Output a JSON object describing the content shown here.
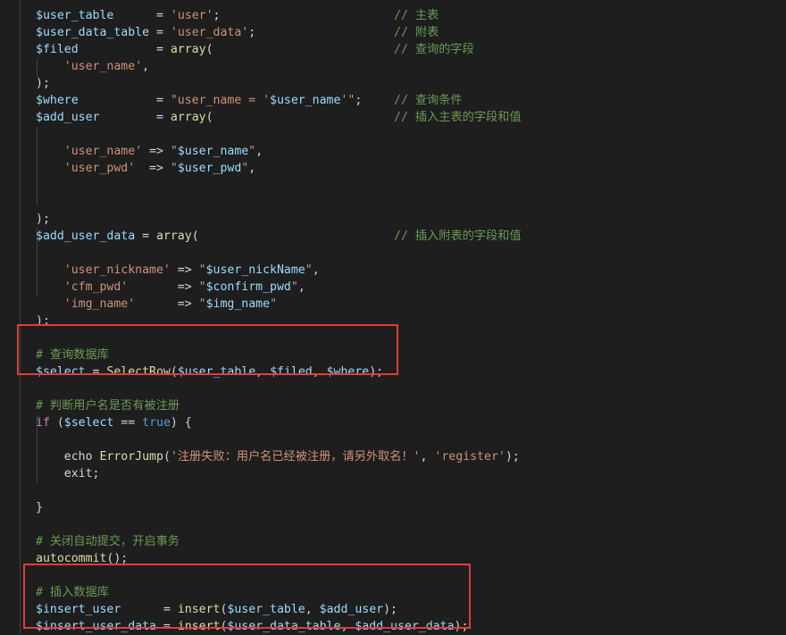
{
  "editor": {
    "theme_colors": {
      "background": "#1e1e1e",
      "variable": "#9cdcfe",
      "string": "#ce9178",
      "function": "#dcdcaa",
      "comment": "#6a9955",
      "keyword": "#569cd6",
      "highlight_box": "#e03c3c"
    },
    "lines": [
      [
        {
          "t": "v",
          "x": "$user_table"
        },
        {
          "t": "p",
          "x": "      = "
        },
        {
          "t": "s",
          "x": "'user'"
        },
        {
          "t": "p",
          "x": ";"
        },
        {
          "t": "c",
          "x": "// 主表",
          "col": 40
        }
      ],
      [
        {
          "t": "v",
          "x": "$user_data_table"
        },
        {
          "t": "p",
          "x": " = "
        },
        {
          "t": "s",
          "x": "'user_data'"
        },
        {
          "t": "p",
          "x": ";"
        },
        {
          "t": "c",
          "x": "// 附表",
          "col": 40
        }
      ],
      [
        {
          "t": "v",
          "x": "$filed"
        },
        {
          "t": "p",
          "x": "           = "
        },
        {
          "t": "f",
          "x": "array"
        },
        {
          "t": "p",
          "x": "("
        },
        {
          "t": "c",
          "x": "// 查询的字段",
          "col": 40
        }
      ],
      [
        {
          "t": "p",
          "x": "    "
        },
        {
          "t": "s",
          "x": "'user_name'"
        },
        {
          "t": "p",
          "x": ","
        }
      ],
      [
        {
          "t": "p",
          "x": ");"
        }
      ],
      [
        {
          "t": "v",
          "x": "$where"
        },
        {
          "t": "p",
          "x": "           = "
        },
        {
          "t": "s",
          "x": "\"user_name = '"
        },
        {
          "t": "v",
          "x": "$user_name"
        },
        {
          "t": "s",
          "x": "'\""
        },
        {
          "t": "p",
          "x": ";"
        },
        {
          "t": "c",
          "x": "// 查询条件",
          "col": 40
        }
      ],
      [
        {
          "t": "v",
          "x": "$add_user"
        },
        {
          "t": "p",
          "x": "        = "
        },
        {
          "t": "f",
          "x": "array"
        },
        {
          "t": "p",
          "x": "("
        },
        {
          "t": "c",
          "x": "// 插入主表的字段和值",
          "col": 40
        }
      ],
      [],
      [
        {
          "t": "p",
          "x": "    "
        },
        {
          "t": "s",
          "x": "'user_name'"
        },
        {
          "t": "p",
          "x": " => "
        },
        {
          "t": "s",
          "x": "\""
        },
        {
          "t": "v",
          "x": "$user_name"
        },
        {
          "t": "s",
          "x": "\""
        },
        {
          "t": "p",
          "x": ","
        }
      ],
      [
        {
          "t": "p",
          "x": "    "
        },
        {
          "t": "s",
          "x": "'user_pwd'"
        },
        {
          "t": "p",
          "x": "  => "
        },
        {
          "t": "s",
          "x": "\""
        },
        {
          "t": "v",
          "x": "$user_pwd"
        },
        {
          "t": "s",
          "x": "\""
        },
        {
          "t": "p",
          "x": ","
        }
      ],
      [],
      [],
      [
        {
          "t": "p",
          "x": ");"
        }
      ],
      [
        {
          "t": "v",
          "x": "$add_user_data"
        },
        {
          "t": "p",
          "x": " = "
        },
        {
          "t": "f",
          "x": "array"
        },
        {
          "t": "p",
          "x": "("
        },
        {
          "t": "c",
          "x": "// 插入附表的字段和值",
          "col": 40
        }
      ],
      [],
      [
        {
          "t": "p",
          "x": "    "
        },
        {
          "t": "s",
          "x": "'user_nickname'"
        },
        {
          "t": "p",
          "x": " => "
        },
        {
          "t": "s",
          "x": "\""
        },
        {
          "t": "v",
          "x": "$user_nickName"
        },
        {
          "t": "s",
          "x": "\""
        },
        {
          "t": "p",
          "x": ","
        }
      ],
      [
        {
          "t": "p",
          "x": "    "
        },
        {
          "t": "s",
          "x": "'cfm_pwd'"
        },
        {
          "t": "p",
          "x": "       => "
        },
        {
          "t": "s",
          "x": "\""
        },
        {
          "t": "v",
          "x": "$confirm_pwd"
        },
        {
          "t": "s",
          "x": "\""
        },
        {
          "t": "p",
          "x": ","
        }
      ],
      [
        {
          "t": "p",
          "x": "    "
        },
        {
          "t": "s",
          "x": "'img_name'"
        },
        {
          "t": "p",
          "x": "      => "
        },
        {
          "t": "s",
          "x": "\""
        },
        {
          "t": "v",
          "x": "$img_name"
        },
        {
          "t": "s",
          "x": "\""
        }
      ],
      [
        {
          "t": "p",
          "x": ");"
        }
      ],
      [],
      [
        {
          "t": "c",
          "x": "# 查询数据库"
        }
      ],
      [
        {
          "t": "v",
          "x": "$select"
        },
        {
          "t": "p",
          "x": " = "
        },
        {
          "t": "f",
          "x": "SelectRow"
        },
        {
          "t": "p",
          "x": "("
        },
        {
          "t": "v",
          "x": "$user_table"
        },
        {
          "t": "p",
          "x": ", "
        },
        {
          "t": "v",
          "x": "$filed"
        },
        {
          "t": "p",
          "x": ", "
        },
        {
          "t": "v",
          "x": "$where"
        },
        {
          "t": "p",
          "x": ");"
        }
      ],
      [],
      [
        {
          "t": "c",
          "x": "# 判断用户名是否有被注册"
        }
      ],
      [
        {
          "t": "cp",
          "x": "if"
        },
        {
          "t": "p",
          "x": " ("
        },
        {
          "t": "v",
          "x": "$select"
        },
        {
          "t": "p",
          "x": " == "
        },
        {
          "t": "k",
          "x": "true"
        },
        {
          "t": "p",
          "x": ") {"
        }
      ],
      [],
      [
        {
          "t": "p",
          "x": "    echo "
        },
        {
          "t": "f",
          "x": "ErrorJump"
        },
        {
          "t": "p",
          "x": "("
        },
        {
          "t": "s",
          "x": "'注册失败：用户名已经被注册，请另外取名！'"
        },
        {
          "t": "p",
          "x": ", "
        },
        {
          "t": "s",
          "x": "'register'"
        },
        {
          "t": "p",
          "x": ");"
        }
      ],
      [
        {
          "t": "p",
          "x": "    exit;"
        }
      ],
      [],
      [
        {
          "t": "p",
          "x": "}"
        }
      ],
      [],
      [
        {
          "t": "c",
          "x": "# 关闭自动提交，开启事务"
        }
      ],
      [
        {
          "t": "f",
          "x": "autocommit"
        },
        {
          "t": "p",
          "x": "();"
        }
      ],
      [],
      [
        {
          "t": "c",
          "x": "# 插入数据库"
        }
      ],
      [
        {
          "t": "v",
          "x": "$insert_user"
        },
        {
          "t": "p",
          "x": "      = "
        },
        {
          "t": "f",
          "x": "insert"
        },
        {
          "t": "p",
          "x": "("
        },
        {
          "t": "v",
          "x": "$user_table"
        },
        {
          "t": "p",
          "x": ", "
        },
        {
          "t": "v",
          "x": "$add_user"
        },
        {
          "t": "p",
          "x": ");"
        }
      ],
      [
        {
          "t": "v",
          "x": "$insert_user_data"
        },
        {
          "t": "p",
          "x": " = "
        },
        {
          "t": "f",
          "x": "insert"
        },
        {
          "t": "p",
          "x": "("
        },
        {
          "t": "v",
          "x": "$user_data_table"
        },
        {
          "t": "p",
          "x": ", "
        },
        {
          "t": "v",
          "x": "$add_user_data"
        },
        {
          "t": "p",
          "x": ");"
        }
      ]
    ]
  }
}
